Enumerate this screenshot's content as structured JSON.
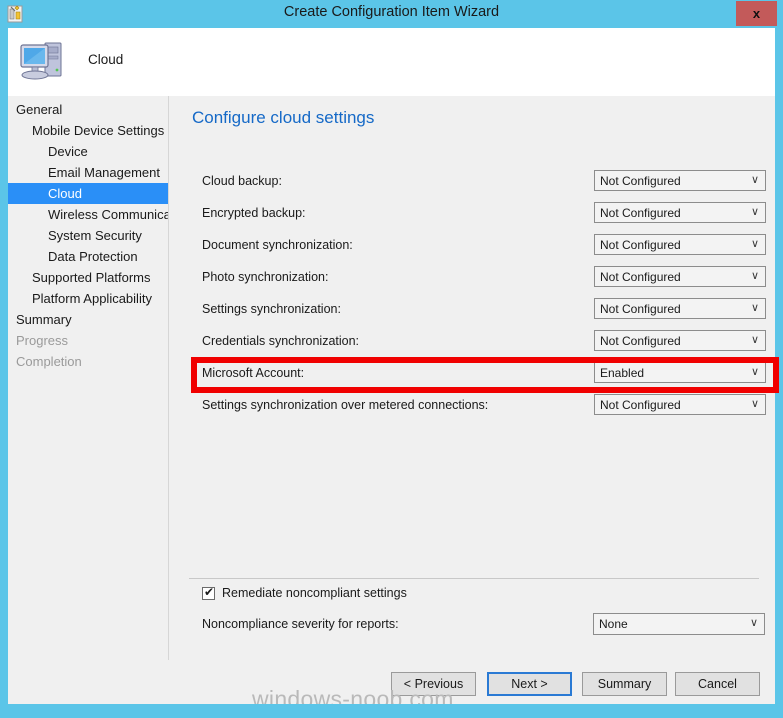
{
  "window": {
    "title": "Create Configuration Item Wizard",
    "title_icon": "wizard-icon",
    "close_label": "x",
    "accent_color": "#5BC5E8",
    "highlight_color": "#F00000"
  },
  "header": {
    "icon": "computer-icon",
    "label": "Cloud"
  },
  "sidebar": {
    "items": [
      {
        "label": "General",
        "level": 0,
        "state": "normal"
      },
      {
        "label": "Mobile Device Settings",
        "level": 1,
        "state": "normal"
      },
      {
        "label": "Device",
        "level": 2,
        "state": "normal"
      },
      {
        "label": "Email Management",
        "level": 2,
        "state": "normal"
      },
      {
        "label": "Cloud",
        "level": 2,
        "state": "selected"
      },
      {
        "label": "Wireless Communicat",
        "level": 2,
        "state": "normal"
      },
      {
        "label": "System Security",
        "level": 2,
        "state": "normal"
      },
      {
        "label": "Data Protection",
        "level": 2,
        "state": "normal"
      },
      {
        "label": "Supported Platforms",
        "level": 1,
        "state": "normal"
      },
      {
        "label": "Platform Applicability",
        "level": 1,
        "state": "normal"
      },
      {
        "label": "Summary",
        "level": 0,
        "state": "normal"
      },
      {
        "label": "Progress",
        "level": 0,
        "state": "disabled"
      },
      {
        "label": "Completion",
        "level": 0,
        "state": "disabled"
      }
    ],
    "scrollbar": {
      "left_arrow": "‹",
      "right_arrow": "›",
      "grip": "❘❘❘"
    }
  },
  "content": {
    "heading": "Configure cloud settings",
    "chevron": "∨",
    "rows": [
      {
        "label": "Cloud backup:",
        "value": "Not Configured",
        "highlighted": false
      },
      {
        "label": "Encrypted backup:",
        "value": "Not Configured",
        "highlighted": false
      },
      {
        "label": "Document synchronization:",
        "value": "Not Configured",
        "highlighted": false
      },
      {
        "label": "Photo synchronization:",
        "value": "Not Configured",
        "highlighted": false
      },
      {
        "label": "Settings synchronization:",
        "value": "Not Configured",
        "highlighted": false
      },
      {
        "label": "Credentials synchronization:",
        "value": "Not Configured",
        "highlighted": false
      },
      {
        "label": "Microsoft Account:",
        "value": "Enabled",
        "highlighted": true
      },
      {
        "label": "Settings synchronization over metered connections:",
        "value": "Not Configured",
        "highlighted": false
      }
    ],
    "remediate": {
      "label": "Remediate noncompliant settings",
      "checked": true,
      "tick": "✔"
    },
    "severity": {
      "label": "Noncompliance severity for reports:",
      "value": "None",
      "chevron": "∨"
    }
  },
  "footer": {
    "previous_label": "< Previous",
    "next_label": "Next >",
    "summary_label": "Summary",
    "cancel_label": "Cancel"
  },
  "watermark": "windows-noob.com"
}
